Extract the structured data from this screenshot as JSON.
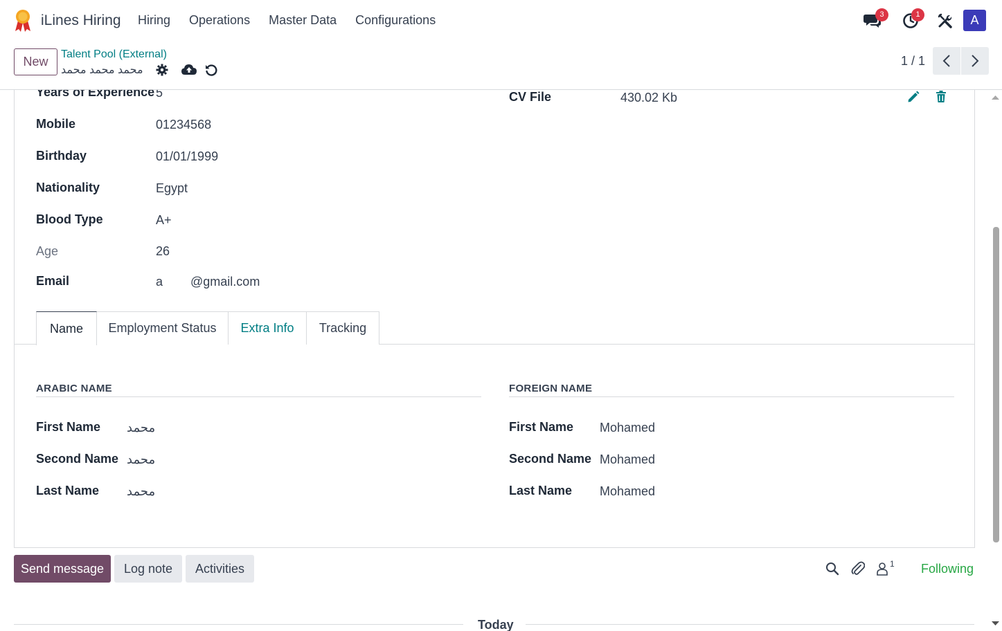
{
  "navbar": {
    "app_name": "iLines Hiring",
    "menu": [
      "Hiring",
      "Operations",
      "Master Data",
      "Configurations"
    ],
    "messages_badge": "3",
    "activities_badge": "1",
    "avatar_letter": "A"
  },
  "control": {
    "new_label": "New",
    "breadcrumb_parent": "Talent Pool (External)",
    "breadcrumb_current": "محمد محمد محمد",
    "pager": "1 / 1"
  },
  "fields_left": [
    {
      "label": "Years of Experience",
      "value": "5"
    },
    {
      "label": "Mobile",
      "value": "01234568"
    },
    {
      "label": "Birthday",
      "value": "01/01/1999"
    },
    {
      "label": "Nationality",
      "value": "Egypt"
    },
    {
      "label": "Blood Type",
      "value": "A+"
    },
    {
      "label": "Age",
      "value": "26"
    },
    {
      "label": "Email",
      "value": "a        @gmail.com"
    }
  ],
  "fields_right": {
    "cv_label": "CV File",
    "cv_value": "430.02 Kb"
  },
  "tabs": [
    "Name",
    "Employment Status",
    "Extra Info",
    "Tracking"
  ],
  "arabic_name": {
    "title": "ARABIC NAME",
    "rows": [
      {
        "label": "First Name",
        "value": "محمد"
      },
      {
        "label": "Second Name",
        "value": "محمد"
      },
      {
        "label": "Last Name",
        "value": "محمد"
      }
    ]
  },
  "foreign_name": {
    "title": "FOREIGN NAME",
    "rows": [
      {
        "label": "First Name",
        "value": "Mohamed"
      },
      {
        "label": "Second Name",
        "value": "Mohamed"
      },
      {
        "label": "Last Name",
        "value": "Mohamed"
      }
    ]
  },
  "chatter": {
    "send_message": "Send message",
    "log_note": "Log note",
    "activities": "Activities",
    "followers_count": "1",
    "following": "Following",
    "today": "Today"
  },
  "colors": {
    "primary": "#714b67",
    "link": "#017e84",
    "badge": "#dc3545",
    "following": "#28a745",
    "avatar": "#3b3bb8"
  }
}
